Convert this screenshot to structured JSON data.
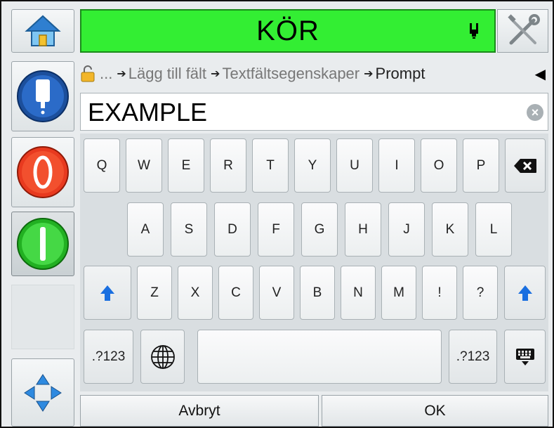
{
  "status": {
    "text": "KÖR",
    "color": "#33ee33",
    "icon": "ink-cartridge-icon"
  },
  "sidebar": {
    "home": "home-icon",
    "ink": "ink-system-icon",
    "stop": "stop-icon",
    "start": "start-icon",
    "navigate": "navigation-arrows-icon"
  },
  "breadcrumb": {
    "ellipsis": "...",
    "items": [
      "Lägg till fält",
      "Textfältsegenskaper",
      "Prompt"
    ],
    "back": "◀"
  },
  "field": {
    "value": "EXAMPLE",
    "clear": "×"
  },
  "keyboard": {
    "row1": [
      "Q",
      "W",
      "E",
      "R",
      "T",
      "Y",
      "U",
      "I",
      "O",
      "P"
    ],
    "row2": [
      "A",
      "S",
      "D",
      "F",
      "G",
      "H",
      "J",
      "K",
      "L"
    ],
    "row3": [
      "Z",
      "X",
      "C",
      "V",
      "B",
      "N",
      "M",
      "!",
      "?"
    ],
    "symbols_left": ".?123",
    "symbols_right": ".?123"
  },
  "buttons": {
    "cancel": "Avbryt",
    "ok": "OK"
  }
}
